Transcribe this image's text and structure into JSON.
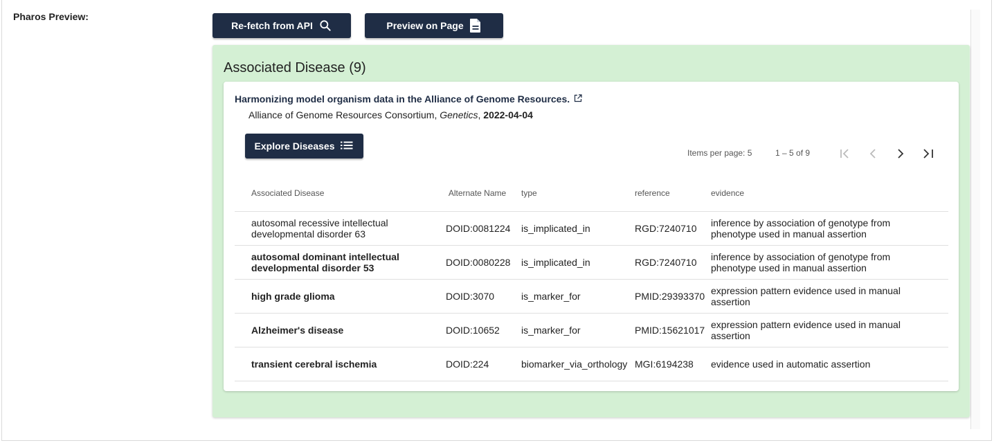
{
  "section_label": "Pharos Preview:",
  "buttons": {
    "refetch": "Re-fetch from API",
    "preview": "Preview on Page",
    "explore": "Explore Diseases"
  },
  "panel": {
    "title": "Associated Disease (9)",
    "reference": {
      "title": "Harmonizing model organism data in the Alliance of Genome Resources.",
      "authors": "Alliance of Genome Resources Consortium",
      "journal": "Genetics",
      "date": "2022-04-04"
    },
    "paginator": {
      "items_per_page": "Items per page: 5",
      "range": "1 – 5 of 9"
    },
    "table": {
      "headers": {
        "disease": "Associated Disease",
        "alt_name": "Alternate Name",
        "type": "type",
        "reference": "reference",
        "evidence": "evidence"
      },
      "rows": [
        {
          "disease": "autosomal recessive intellectual developmental disorder 63",
          "alt_name": "DOID:0081224",
          "type": "is_implicated_in",
          "reference": "RGD:7240710",
          "evidence": "inference by association of genotype from phenotype used in manual assertion"
        },
        {
          "disease": "autosomal dominant intellectual developmental disorder 53",
          "alt_name": "DOID:0080228",
          "type": "is_implicated_in",
          "reference": "RGD:7240710",
          "evidence": "inference by association of genotype from phenotype used in manual assertion"
        },
        {
          "disease": "high grade glioma",
          "alt_name": "DOID:3070",
          "type": "is_marker_for",
          "reference": "PMID:29393370",
          "evidence": "expression pattern evidence used in manual assertion"
        },
        {
          "disease": "Alzheimer's disease",
          "alt_name": "DOID:10652",
          "type": "is_marker_for",
          "reference": "PMID:15621017",
          "evidence": "expression pattern evidence used in manual assertion"
        },
        {
          "disease": "transient cerebral ischemia",
          "alt_name": "DOID:224",
          "type": "biomarker_via_orthology",
          "reference": "MGI:6194238",
          "evidence": "evidence used in automatic assertion"
        }
      ]
    }
  },
  "colors": {
    "button_bg": "#1f2d45",
    "panel_bg": "#d4f0d4",
    "link_text": "#1f2d45"
  },
  "icons": {
    "refetch": "search-icon",
    "preview": "document-icon",
    "reference_link": "external-link-icon",
    "explore": "list-icon",
    "first_page": "first-page-icon",
    "prev_page": "chevron-left-icon",
    "next_page": "chevron-right-icon",
    "last_page": "last-page-icon"
  }
}
